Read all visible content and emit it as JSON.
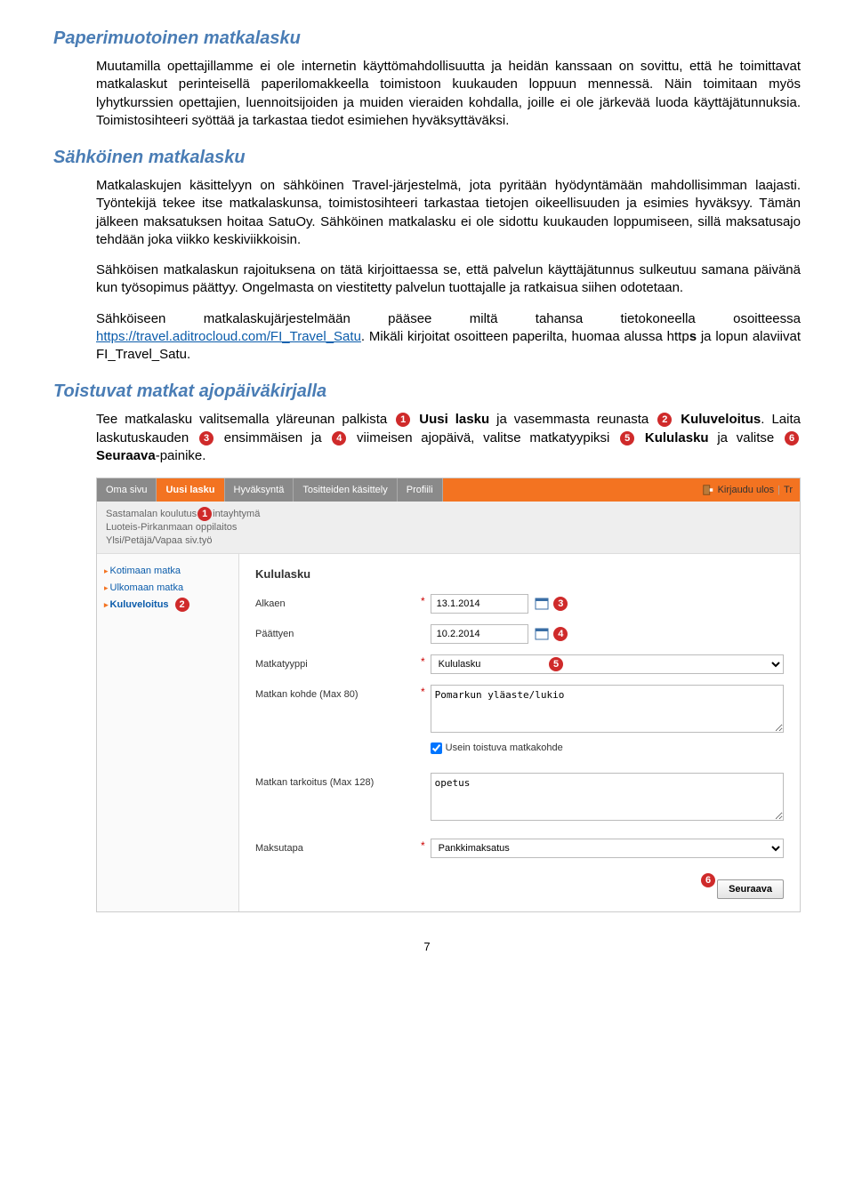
{
  "headings": {
    "h1": "Paperimuotoinen matkalasku",
    "h2": "Sähköinen matkalasku",
    "h3": "Toistuvat matkat ajopäiväkirjalla"
  },
  "paragraphs": {
    "p1": "Muutamilla opettajillamme ei ole internetin käyttömahdollisuutta ja heidän kanssaan on sovittu, että he toimittavat matkalaskut perinteisellä paperilomakkeella toimistoon kuukauden loppuun mennessä. Näin toimitaan myös lyhytkurssien opettajien, luennoitsijoiden ja muiden vieraiden kohdalla, joille ei ole järkevää luoda käyttäjätunnuksia. Toimistosihteeri syöttää ja tarkastaa tiedot esimiehen hyväksyttäväksi.",
    "p2": "Matkalaskujen käsittelyyn on sähköinen Travel-järjestelmä, jota pyritään hyödyntämään mahdollisimman laajasti. Työntekijä tekee itse matkalaskunsa, toimistosihteeri tarkastaa tietojen oikeellisuuden ja esimies hyväksyy. Tämän jälkeen maksatuksen hoitaa SatuOy. Sähköinen matkalasku ei ole sidottu kuukauden loppumiseen, sillä maksatusajo tehdään joka viikko keskiviikkoisin.",
    "p3": "Sähköisen matkalaskun rajoituksena on tätä kirjoittaessa se, että palvelun käyttäjätunnus sulkeutuu samana päivänä kun työsopimus päättyy. Ongelmasta on viestitetty palvelun tuottajalle ja ratkaisua siihen odotetaan.",
    "p4_a": "Sähköiseen matkalaskujärjestelmään pääsee miltä tahansa tietokoneella osoitteessa ",
    "p4_link": "https://travel.aditrocloud.com/FI_Travel_Satu",
    "p4_b": ". Mikäli kirjoitat osoitteen paperilta, huomaa alussa http",
    "p4_c": " ja lopun alaviivat FI_Travel_Satu.",
    "p5_a": "Tee matkalasku valitsemalla yläreunan palkista ",
    "p5_b": " Uusi lasku",
    "p5_c": " ja vasemmasta reunasta ",
    "p5_d": " Kuluveloitus",
    "p5_e": ". Laita laskutuskauden ",
    "p5_f": " ensimmäisen ja ",
    "p5_g": " viimeisen ajopäivä, valitse matkatyypiksi ",
    "p5_h": " Kululasku",
    "p5_i": " ja valitse ",
    "p5_j": " Seuraava",
    "p5_k": "-painike."
  },
  "mock": {
    "tabs": {
      "omasivu": "Oma sivu",
      "uusilasku": "Uusi lasku",
      "hyvaksynta": "Hyväksyntä",
      "tositteet": "Tositteiden käsittely",
      "profiili": "Profiili"
    },
    "logout": "Kirjaudu ulos",
    "tr": "Tr",
    "sub1": "Sastamalan koulutus",
    "sub1b": "intayhtymä",
    "sub2": "Luoteis-Pirkanmaan oppilaitos",
    "sub3": "Ylsi/Petäjä/Vapaa siv.työ",
    "side": {
      "kotimaan": "Kotimaan matka",
      "ulkomaan": "Ulkomaan matka",
      "kuluveloitus": "Kuluveloitus"
    },
    "form": {
      "title": "Kululasku",
      "alkaen": "Alkaen",
      "paattyen": "Päättyen",
      "matkatyyppi": "Matkatyyppi",
      "kohde": "Matkan kohde (Max 80)",
      "toistuva": "Usein toistuva matkakohde",
      "tarkoitus": "Matkan tarkoitus (Max 128)",
      "maksutapa": "Maksutapa",
      "val_alkaen": "13.1.2014",
      "val_paattyen": "10.2.2014",
      "val_tyyppi": "Kululasku",
      "val_kohde": "Pomarkun yläaste/lukio",
      "val_tarkoitus": "opetus",
      "val_maksutapa": "Pankkimaksatus",
      "seuraava": "Seuraava"
    }
  },
  "pagenum": "7"
}
